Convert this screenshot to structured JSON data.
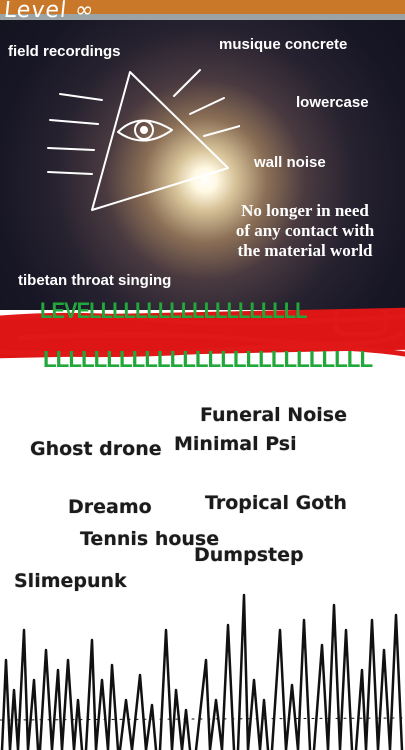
{
  "header": {
    "title": "Level ∞"
  },
  "labels": {
    "field_recordings": "field recordings",
    "musique_concrete": "musique concrete",
    "lowercase": "lowercase",
    "wall_noise": "wall noise",
    "tibetan_throat_singing": "tibetan throat singing"
  },
  "caption": {
    "line1": "No longer in need",
    "line2": "of any contact with",
    "line3": "the material world"
  },
  "banner": {
    "level_text": "LEVELLLLLLLLLLLLLLLLLLL",
    "l_row": "LLLLLLLLLLLLLLLLLLLLLLLLLL"
  },
  "genres": {
    "funeral_noise": "Funeral Noise",
    "ghost_drone": "Ghost drone",
    "minimal_psi": "Minimal Psi",
    "dreamo": "Dreamo",
    "tropical_goth": "Tropical Goth",
    "tennis_house": "Tennis house",
    "dumpstep": "Dumpstep",
    "slimepunk": "Slimepunk"
  },
  "colors": {
    "banner_red": "#dd1515",
    "banner_green": "#22a83a",
    "ink": "#111111"
  }
}
